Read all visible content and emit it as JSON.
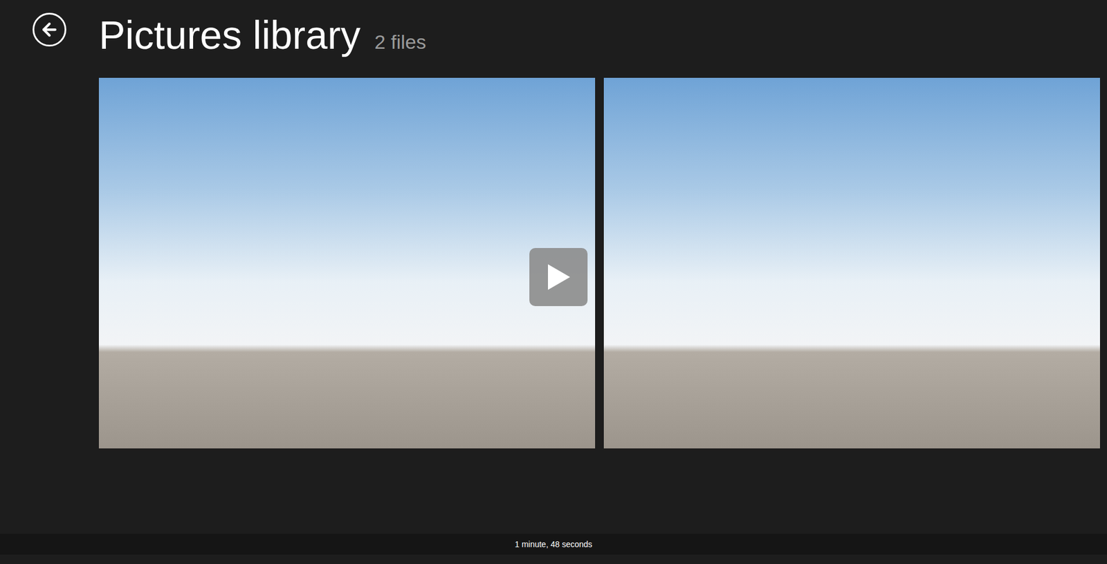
{
  "window": {
    "title": "Pictures library",
    "count": "2 files"
  },
  "files": [
    {
      "kind": "photo"
    },
    {
      "kind": "photo"
    }
  ],
  "status_bar": "1 minute, 48 seconds"
}
